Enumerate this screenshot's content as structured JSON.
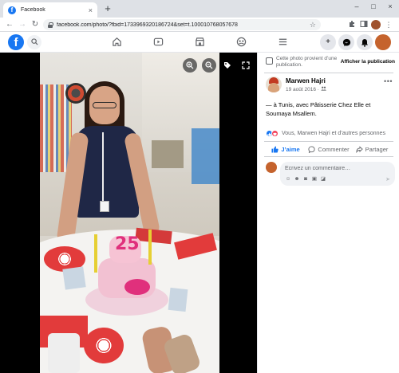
{
  "browser": {
    "tab_title": "Facebook",
    "tab_close": "×",
    "new_tab": "+",
    "url": "facebook.com/photo/?fbid=1733969320186724&set=t.100010768057678",
    "window_controls": [
      "–",
      "□",
      "×"
    ],
    "nav": {
      "back": "←",
      "forward": "→",
      "reload": "↻"
    },
    "star": "☆",
    "extensions": [
      "puzzle-icon",
      "sidebar-icon",
      "profile-avatar",
      "menu-icon"
    ]
  },
  "fb": {
    "logo": "f",
    "nav_icons": [
      "home-icon",
      "watch-icon",
      "marketplace-icon",
      "groups-icon",
      "menu-icon"
    ],
    "right_icons": [
      "create-icon",
      "messenger-icon",
      "notifications-icon",
      "account-avatar"
    ]
  },
  "viewer": {
    "controls": [
      "zoom-in-icon",
      "zoom-out-icon",
      "tag-icon",
      "fullscreen-icon"
    ]
  },
  "panel": {
    "notice_text": "Cette photo provient d’une publication.",
    "notice_link": "Afficher la publication",
    "author": "Marwen Hajri",
    "date": "19 août 2016 · ",
    "more": "•••",
    "caption": "— à Tunis, avec Pâtisserie Chez Elle et Soumaya Msallem.",
    "reactions_text": "Vous, Marwen Hajri et d’autres personnes",
    "actions": {
      "like": "J’aime",
      "comment": "Commenter",
      "share": "Partager"
    },
    "comment_placeholder": "Écrivez un commentaire…"
  },
  "colors": {
    "facebook_blue": "#1877f2",
    "love_red": "#f33e58",
    "secondary_text": "#65676b"
  }
}
